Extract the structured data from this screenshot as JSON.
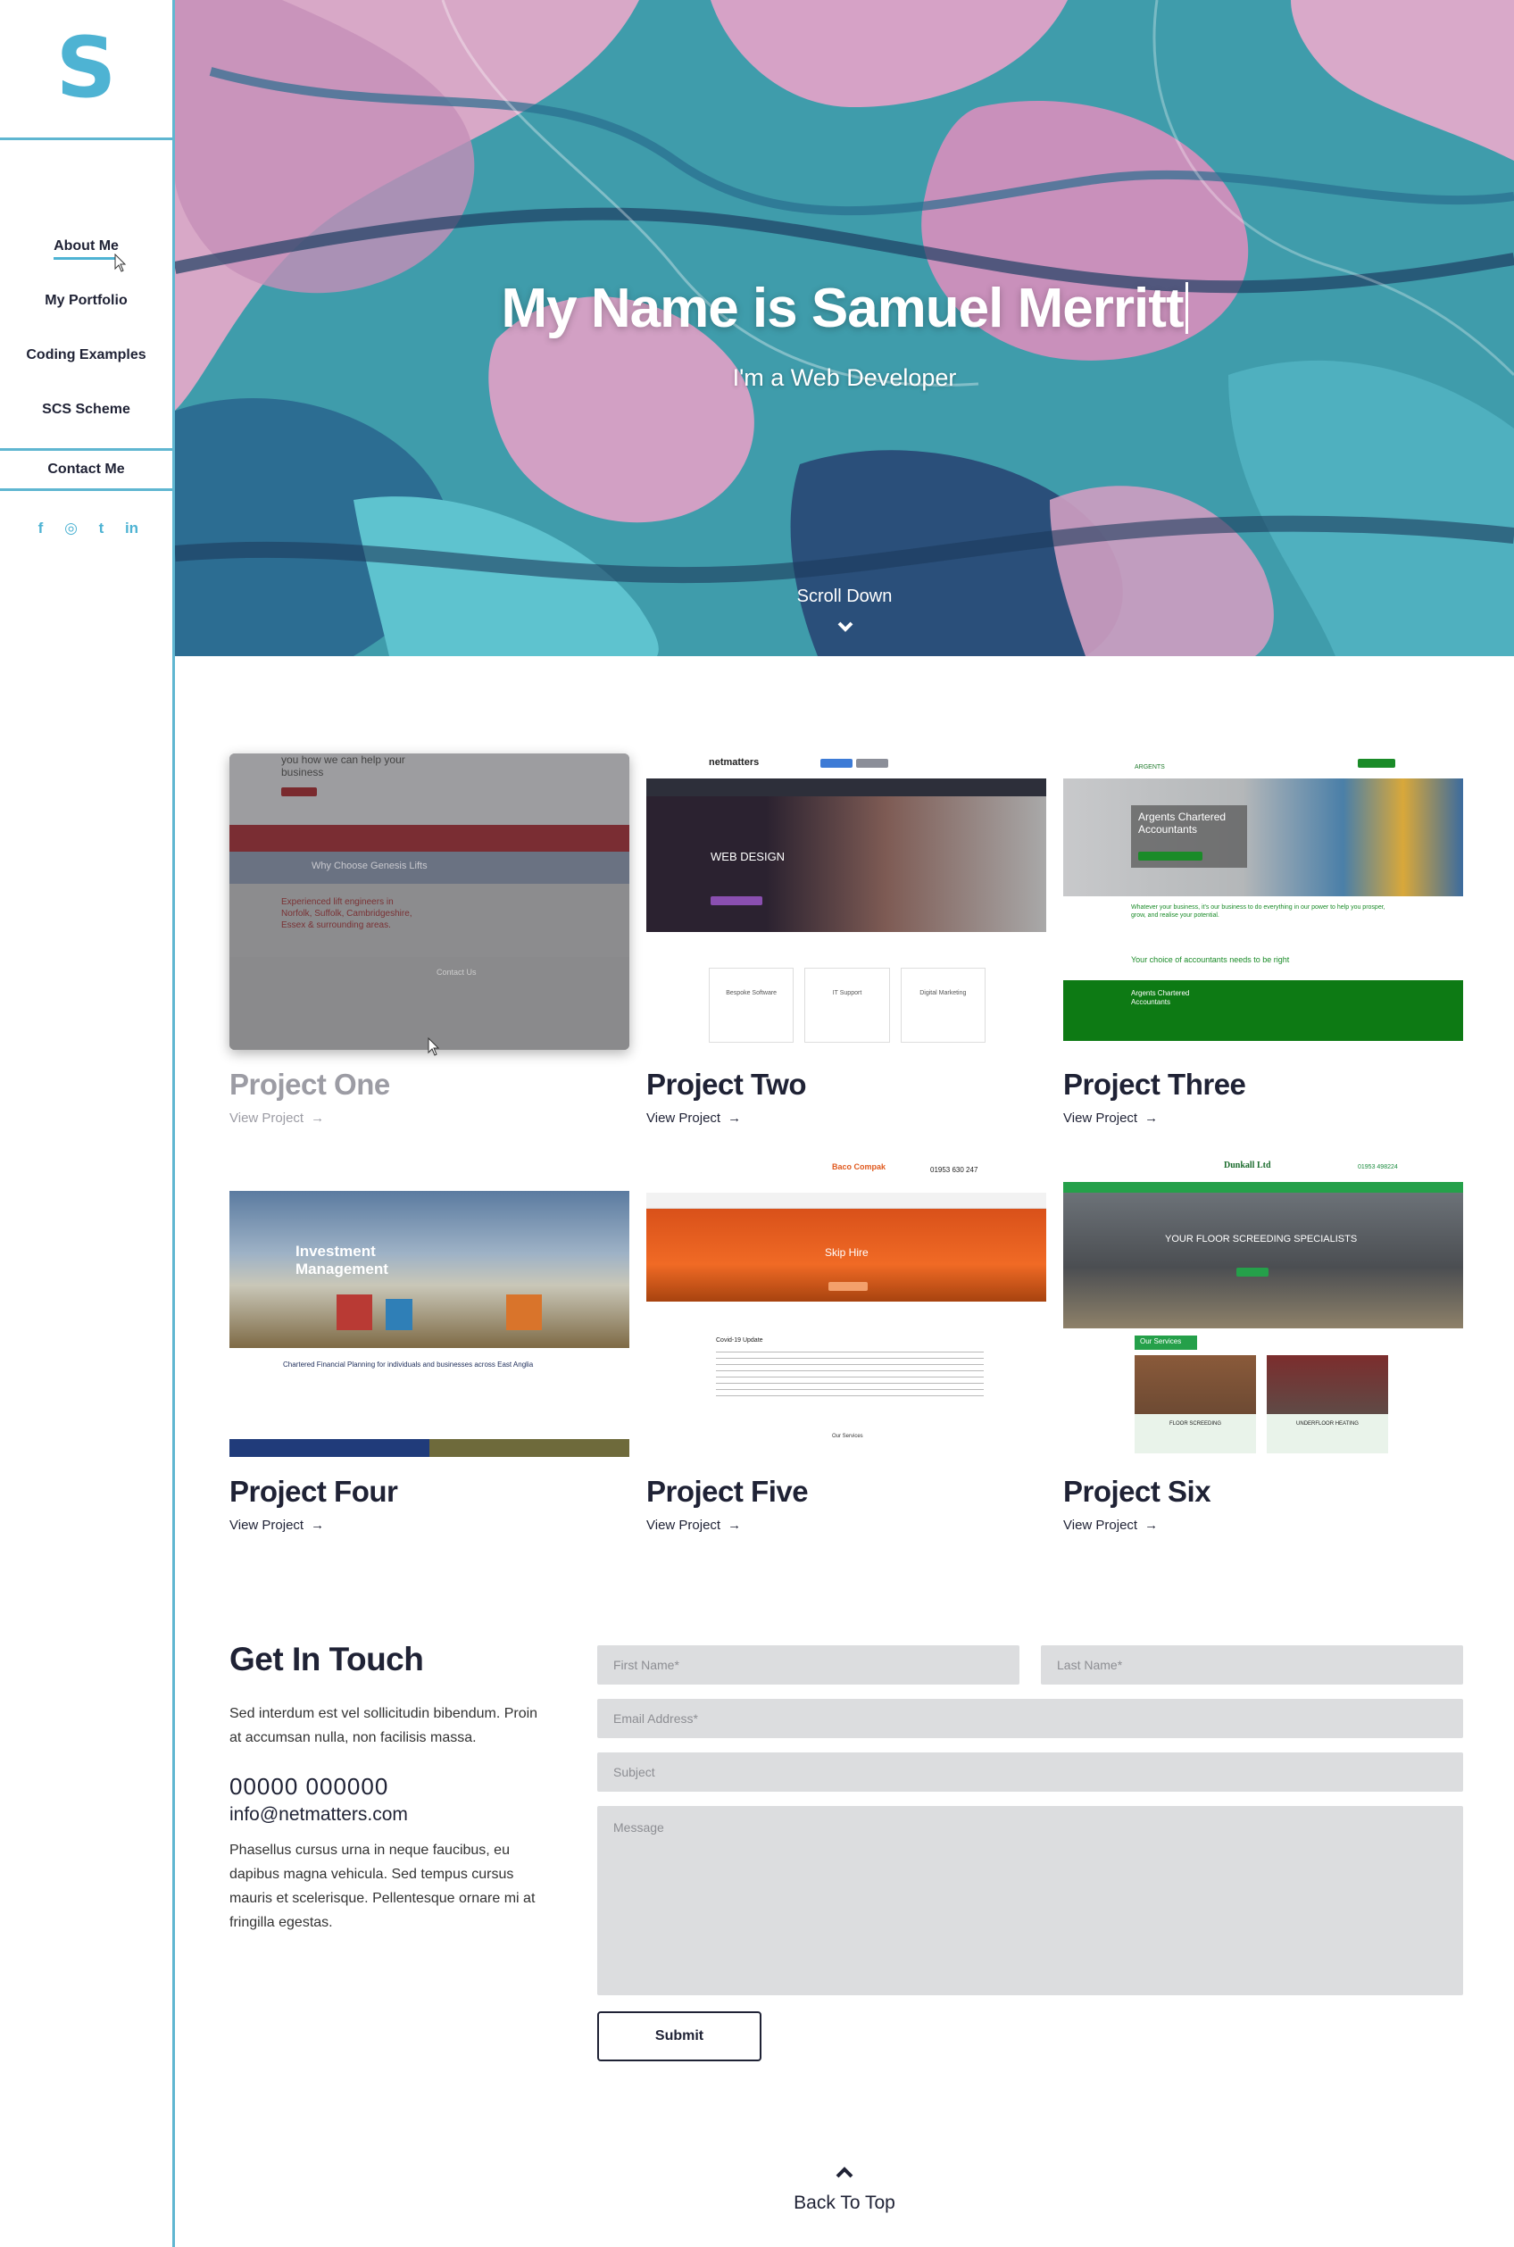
{
  "sidebar": {
    "logo": "S",
    "nav": [
      "About Me",
      "My Portfolio",
      "Coding Examples",
      "SCS Scheme"
    ],
    "contact": "Contact Me",
    "socials": [
      "f",
      "◎",
      "t",
      "in"
    ]
  },
  "hero": {
    "title": "My Name is Samuel Merritt",
    "subtitle": "I'm a Web Developer",
    "scroll": "Scroll Down"
  },
  "projects": [
    {
      "title": "Project One",
      "link": "View Project",
      "state": "hovered",
      "thumb": {
        "headline": "you how we can help your business",
        "banner": "Why Choose Genesis Lifts",
        "body": "Experienced lift engineers in Norfolk, Suffolk, Cambridgeshire, Essex & surrounding areas.",
        "contact": "Contact Us"
      }
    },
    {
      "title": "Project Two",
      "link": "View Project",
      "thumb": {
        "brand": "netmatters",
        "headline": "WEB DESIGN",
        "tiles": [
          "Bespoke Software",
          "IT Support",
          "Digital Marketing"
        ]
      }
    },
    {
      "title": "Project Three",
      "link": "View Project",
      "thumb": {
        "brand": "ARGENTS",
        "headline": "Argents Chartered Accountants",
        "tagline": "Whatever your business, it's our business to do everything in our power to help you prosper, grow, and realise your potential.",
        "subhead": "Your choice of accountants needs to be right",
        "footer": "Argents Chartered Accountants"
      }
    },
    {
      "title": "Project Four",
      "link": "View Project",
      "thumb": {
        "headline": "Investment Management",
        "caption": "Chartered Financial Planning for individuals and businesses across East Anglia"
      }
    },
    {
      "title": "Project Five",
      "link": "View Project",
      "thumb": {
        "brand": "Baco Compak",
        "phone": "01953 630 247",
        "headline": "Skip Hire",
        "section": "Covid-19 Update",
        "footer": "Our Services"
      }
    },
    {
      "title": "Project Six",
      "link": "View Project",
      "thumb": {
        "brand": "Dunkall Ltd",
        "phone": "01953 498224",
        "headline": "YOUR FLOOR SCREEDING SPECIALISTS",
        "badge": "Our Services",
        "tiles": [
          "FLOOR SCREEDING",
          "UNDERFLOOR HEATING"
        ]
      }
    }
  ],
  "contact": {
    "title": "Get In Touch",
    "intro": "Sed interdum est vel sollicitudin bibendum. Proin at accumsan nulla, non facilisis massa.",
    "phone": "00000 000000",
    "email": "info@netmatters.com",
    "outro": "Phasellus cursus urna in neque faucibus, eu dapibus magna vehicula. Sed tempus cursus mauris et scelerisque. Pellentesque ornare mi at fringilla egestas.",
    "form": {
      "first_name": "First Name*",
      "last_name": "Last Name*",
      "email": "Email Address*",
      "subject": "Subject",
      "message": "Message",
      "submit": "Submit"
    }
  },
  "back_to_top": "Back To Top",
  "colors": {
    "accent": "#4eb3d3",
    "text": "#1f2235",
    "field": "#dcdddf"
  }
}
